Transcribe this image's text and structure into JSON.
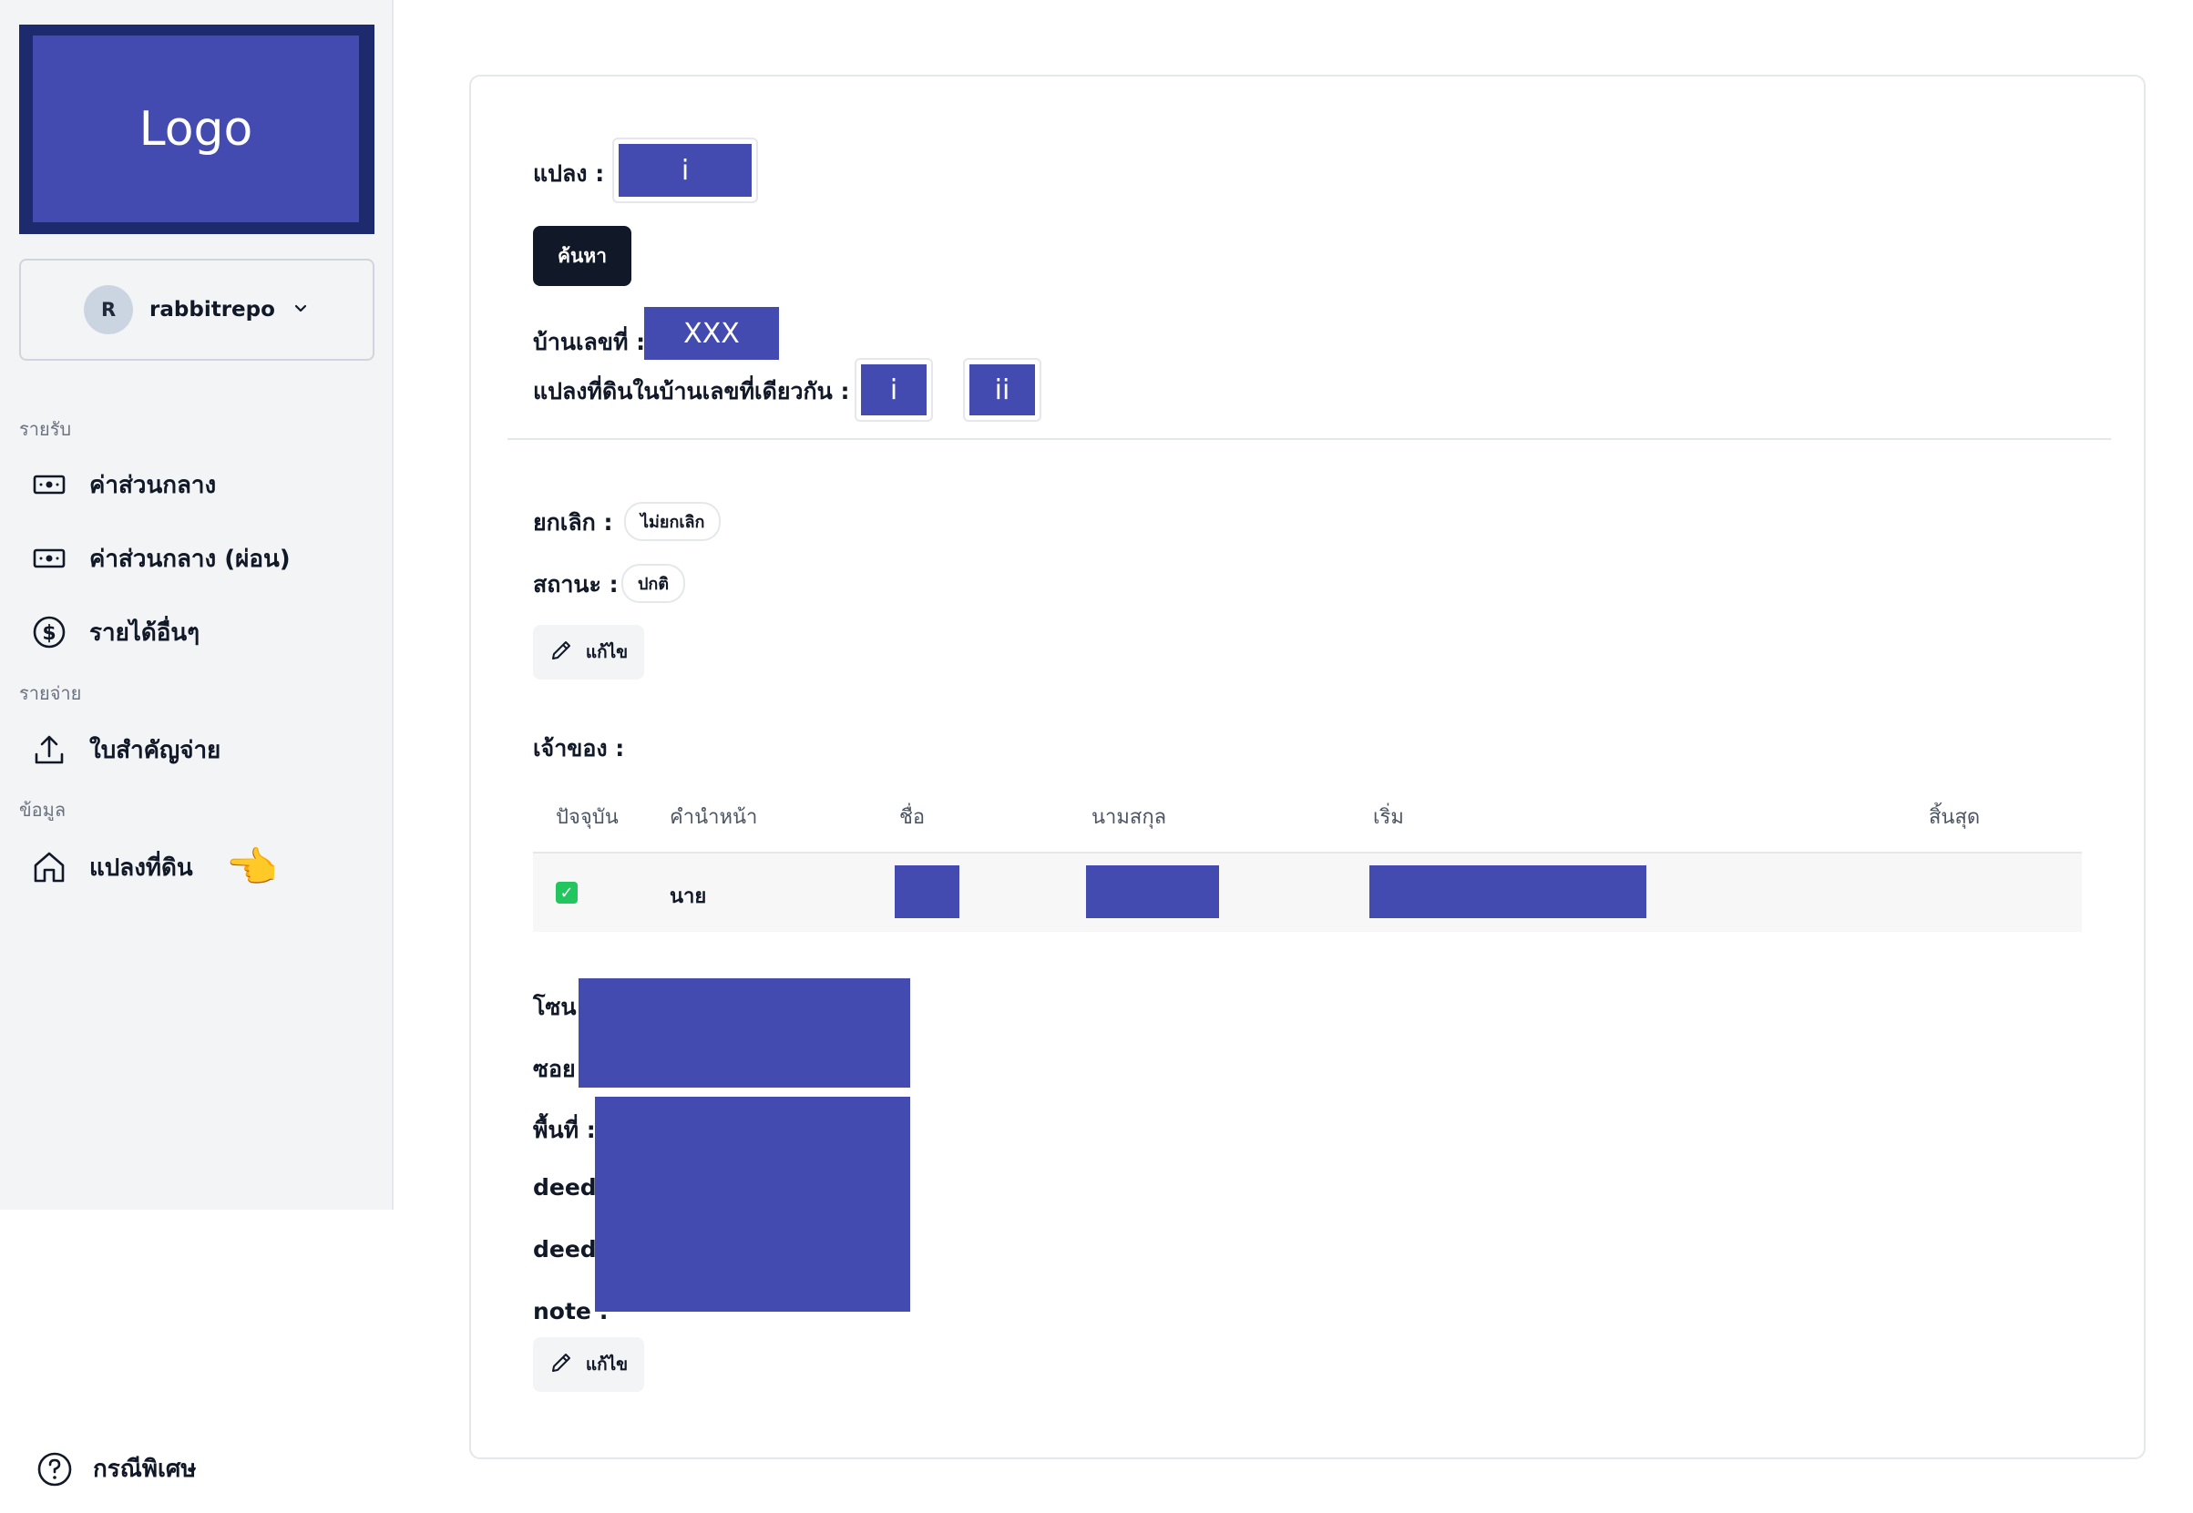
{
  "logo": {
    "text": "Logo"
  },
  "user": {
    "initial": "R",
    "name": "rabbitrepo"
  },
  "sidebar": {
    "sections": [
      {
        "label": "รายรับ"
      },
      {
        "label": "รายจ่าย"
      },
      {
        "label": "ข้อมูล"
      }
    ],
    "items": [
      {
        "label": "ค่าส่วนกลาง",
        "icon": "cash-icon"
      },
      {
        "label": "ค่าส่วนกลาง (ผ่อน)",
        "icon": "cash-icon"
      },
      {
        "label": "รายได้อื่นๆ",
        "icon": "dollar-circle-icon"
      },
      {
        "label": "ใบสำคัญจ่าย",
        "icon": "upload-icon"
      },
      {
        "label": "แปลงที่ดิน",
        "icon": "home-icon",
        "pointer": "👈"
      }
    ],
    "bottom": {
      "label": "กรณีพิเศษ",
      "icon": "help-circle-icon"
    }
  },
  "plot": {
    "label": "แปลง :",
    "value": "i",
    "search_button": "ค้นหา",
    "house_label": "บ้านเลขที่ :",
    "house_value": "XXX",
    "same_house_label": "แปลงที่ดินในบ้านเลขที่เดียวกัน :",
    "same_house_plots": [
      "i",
      "ii"
    ]
  },
  "status": {
    "cancel_label": "ยกเลิก :",
    "cancel_value": "ไม่ยกเลิก",
    "state_label": "สถานะ :",
    "state_value": "ปกติ",
    "edit_button": "แก้ไข"
  },
  "owners": {
    "title": "เจ้าของ :",
    "columns": [
      "ปัจจุบัน",
      "คำนำหน้า",
      "ชื่อ",
      "นามสกุล",
      "เริ่ม",
      "สิ้นสุด"
    ],
    "rows": [
      {
        "current": true,
        "prefix": "นาย"
      }
    ]
  },
  "details": {
    "labels": [
      "โซน :",
      "ซอย",
      "พื้นที่ :",
      "deed :",
      "deed",
      "note :"
    ],
    "edit_button": "แก้ไข"
  }
}
